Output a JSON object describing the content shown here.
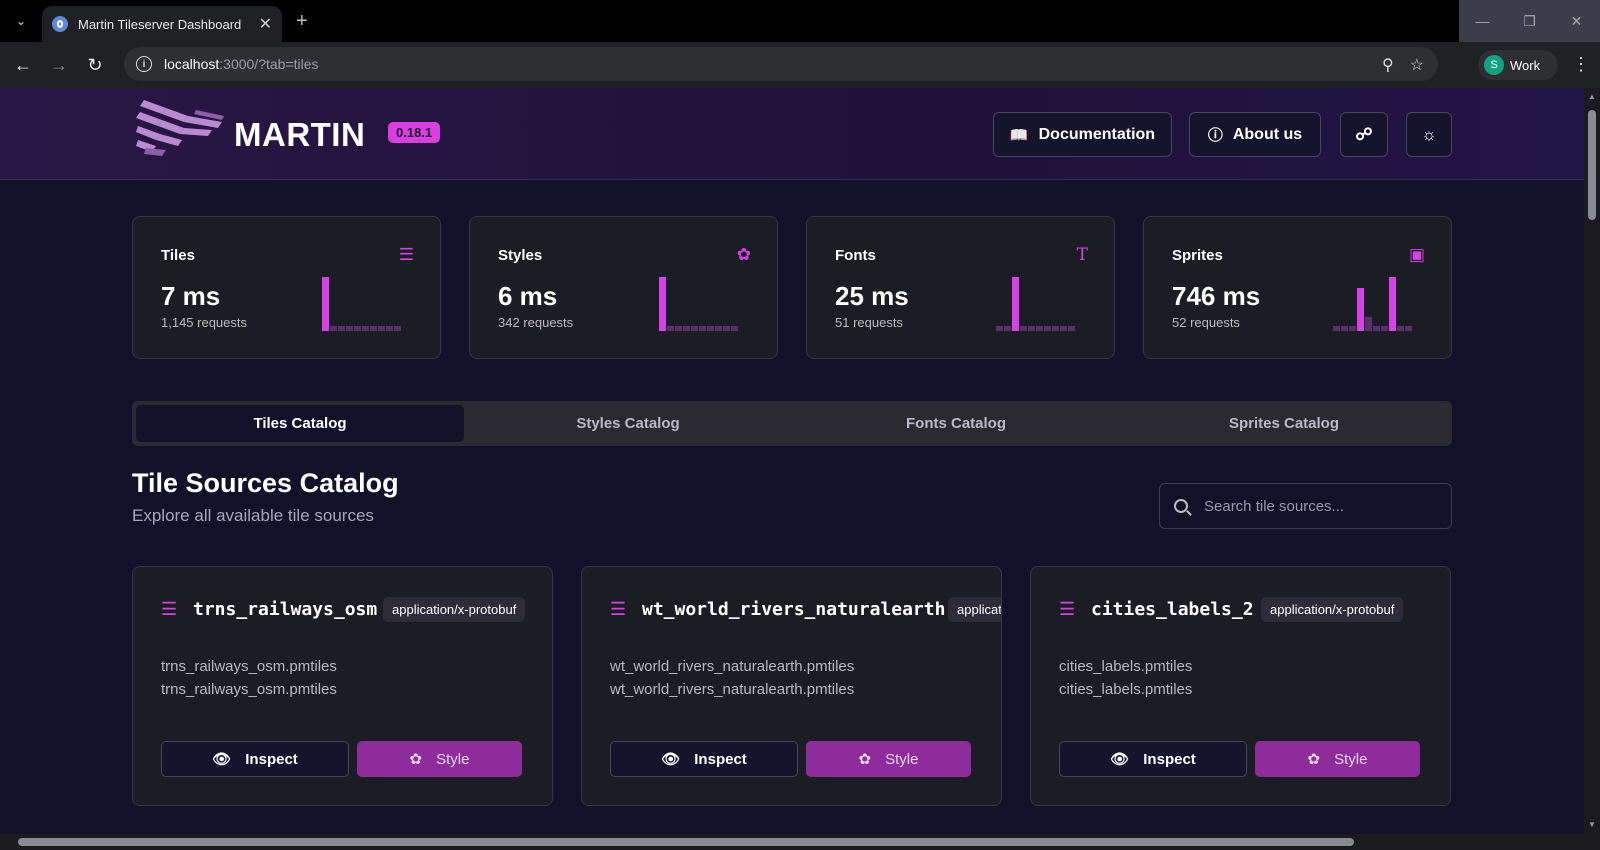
{
  "browser": {
    "tab_title": "Martin Tileserver Dashboard",
    "url_host": "localhost",
    "url_rest": ":3000/?tab=tiles",
    "profile_initial": "S",
    "profile_name": "Work"
  },
  "header": {
    "brand": "MARTIN",
    "version": "0.18.1",
    "documentation_label": "Documentation",
    "about_label": "About us"
  },
  "stats": [
    {
      "label": "Tiles",
      "value": "7 ms",
      "requests": "1,145 requests",
      "icon": "layers-icon",
      "spark": [
        1.0,
        0.1,
        0.1,
        0.1,
        0.1,
        0.1,
        0.1,
        0.1,
        0.1,
        0.1
      ]
    },
    {
      "label": "Styles",
      "value": "6 ms",
      "requests": "342 requests",
      "icon": "palette-icon",
      "spark": [
        1.0,
        0.1,
        0.1,
        0.1,
        0.1,
        0.1,
        0.1,
        0.1,
        0.1,
        0.1
      ]
    },
    {
      "label": "Fonts",
      "value": "25 ms",
      "requests": "51 requests",
      "icon": "type-icon",
      "spark": [
        0.1,
        0.1,
        1.0,
        0.1,
        0.1,
        0.1,
        0.1,
        0.1,
        0.1,
        0.1
      ]
    },
    {
      "label": "Sprites",
      "value": "746 ms",
      "requests": "52 requests",
      "icon": "image-icon",
      "spark": [
        0.1,
        0.1,
        0.1,
        0.8,
        0.25,
        0.1,
        0.1,
        1.0,
        0.1,
        0.1
      ]
    }
  ],
  "tabs": [
    {
      "label": "Tiles Catalog",
      "active": true
    },
    {
      "label": "Styles Catalog",
      "active": false
    },
    {
      "label": "Fonts Catalog",
      "active": false
    },
    {
      "label": "Sprites Catalog",
      "active": false
    }
  ],
  "catalog": {
    "title": "Tile Sources Catalog",
    "subtitle": "Explore all available tile sources",
    "search_placeholder": "Search tile sources...",
    "inspect_label": "Inspect",
    "style_label": "Style"
  },
  "sources": [
    {
      "name": "trns_railways_osm",
      "type": "application/x-protobuf",
      "paths": [
        "trns_railways_osm.pmtiles",
        "trns_railways_osm.pmtiles"
      ]
    },
    {
      "name": "wt_world_rivers_naturalearth",
      "type": "application/x-protobuf",
      "paths": [
        "wt_world_rivers_naturalearth.pmtiles",
        "wt_world_rivers_naturalearth.pmtiles"
      ]
    },
    {
      "name": "cities_labels_2",
      "type": "application/x-protobuf",
      "paths": [
        "cities_labels.pmtiles",
        "cities_labels.pmtiles"
      ]
    }
  ],
  "colors": {
    "accent": "#d543e6",
    "style_button": "#8e2c9b",
    "background": "#13112a"
  }
}
